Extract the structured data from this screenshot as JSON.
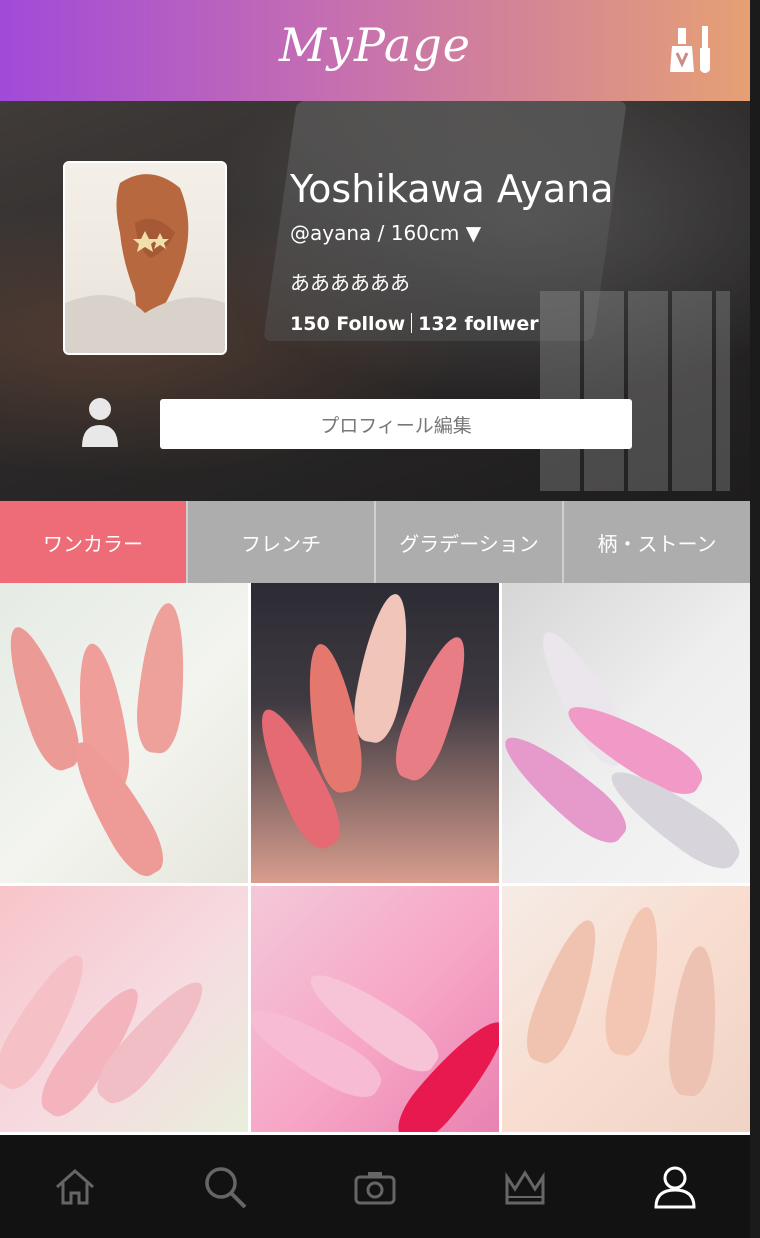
{
  "header": {
    "title": "MyPage",
    "polish_icon": "nail-polish-icon"
  },
  "profile": {
    "name": "Yoshikawa Ayana",
    "handle_line": "@ayana / 160cm ▼",
    "bio": "ああああああ",
    "follow_label": "150 Follow",
    "follower_label": "132 follwer",
    "edit_button": "プロフィール編集"
  },
  "tabs": [
    {
      "label": "ワンカラー",
      "active": true
    },
    {
      "label": "フレンチ",
      "active": false
    },
    {
      "label": "グラデーション",
      "active": false
    },
    {
      "label": "柄・ストーン",
      "active": false
    }
  ],
  "nav": [
    {
      "icon": "home-icon",
      "active": false
    },
    {
      "icon": "search-icon",
      "active": false
    },
    {
      "icon": "camera-icon",
      "active": false
    },
    {
      "icon": "crown-icon",
      "active": false
    },
    {
      "icon": "user-icon",
      "active": true
    }
  ],
  "colors": {
    "active_tab": "#ee6b78",
    "inactive_tab": "#adadad",
    "header_gradient_start": "#a14ad9",
    "header_gradient_end": "#e6a074"
  }
}
